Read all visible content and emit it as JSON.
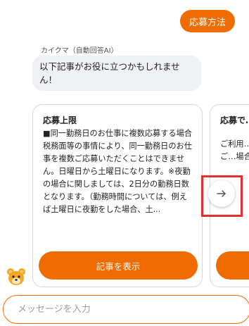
{
  "chat": {
    "user_message": "応募方法",
    "bot_name": "カイクマ（自動回答AI）",
    "bot_message": "以下記事がお役に立つかもしれません！"
  },
  "cards": [
    {
      "title": "応募上限",
      "body": "■同一勤務日のお仕事に複数応募する場合税務面等の事情により、同一勤務日のお仕事を複数ご応募いただくことはできません。日曜日から土曜日になります。※夜勤の場合に関しましては、2日分の勤務日数となります。（勤務時間については、例えば土曜日に夜勤をした場合、土...",
      "button_label": "記事を表示"
    },
    {
      "title": "応募で…ない",
      "body": "ご利用…になり…クップで…すの…ルのご…場合▼…※上記…",
      "button_label": ""
    }
  ],
  "carousel": {
    "next_icon": "arrow-right-icon"
  },
  "input": {
    "placeholder": "メッセージを入力",
    "value": ""
  },
  "colors": {
    "accent": "#f06c00",
    "highlight": "#e53030",
    "bot_bubble_bg": "#f0f1f4"
  }
}
